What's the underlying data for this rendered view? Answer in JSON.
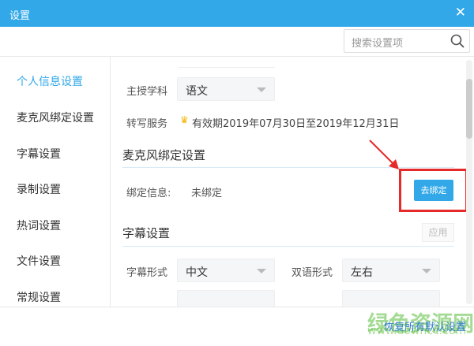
{
  "title": "设置",
  "search": {
    "placeholder": "搜索设置项"
  },
  "sidebar": {
    "items": [
      {
        "label": "个人信息设置"
      },
      {
        "label": "麦克风绑定设置"
      },
      {
        "label": "字幕设置"
      },
      {
        "label": "录制设置"
      },
      {
        "label": "热词设置"
      },
      {
        "label": "文件设置"
      },
      {
        "label": "常规设置"
      }
    ]
  },
  "profile": {
    "subject_label": "主授学科",
    "subject_value": "语文",
    "service_label": "转写服务",
    "service_value": "有效期2019年07月30日至2019年12月31日"
  },
  "mic": {
    "heading": "麦克风绑定设置",
    "bind_label": "绑定信息:",
    "bind_value": "未绑定",
    "bind_button": "去绑定"
  },
  "subtitle": {
    "heading": "字幕设置",
    "apply": "应用",
    "form_label": "字幕形式",
    "form_value": "中文",
    "bilingual_label": "双语形式",
    "bilingual_value": "左右"
  },
  "footer": {
    "restore": "恢复所有默认设置"
  },
  "watermark": {
    "text": "绿色资源网",
    "url": "www.downcc.com"
  },
  "colors": {
    "accent": "#32a8e8",
    "highlight": "#e62a2a"
  }
}
